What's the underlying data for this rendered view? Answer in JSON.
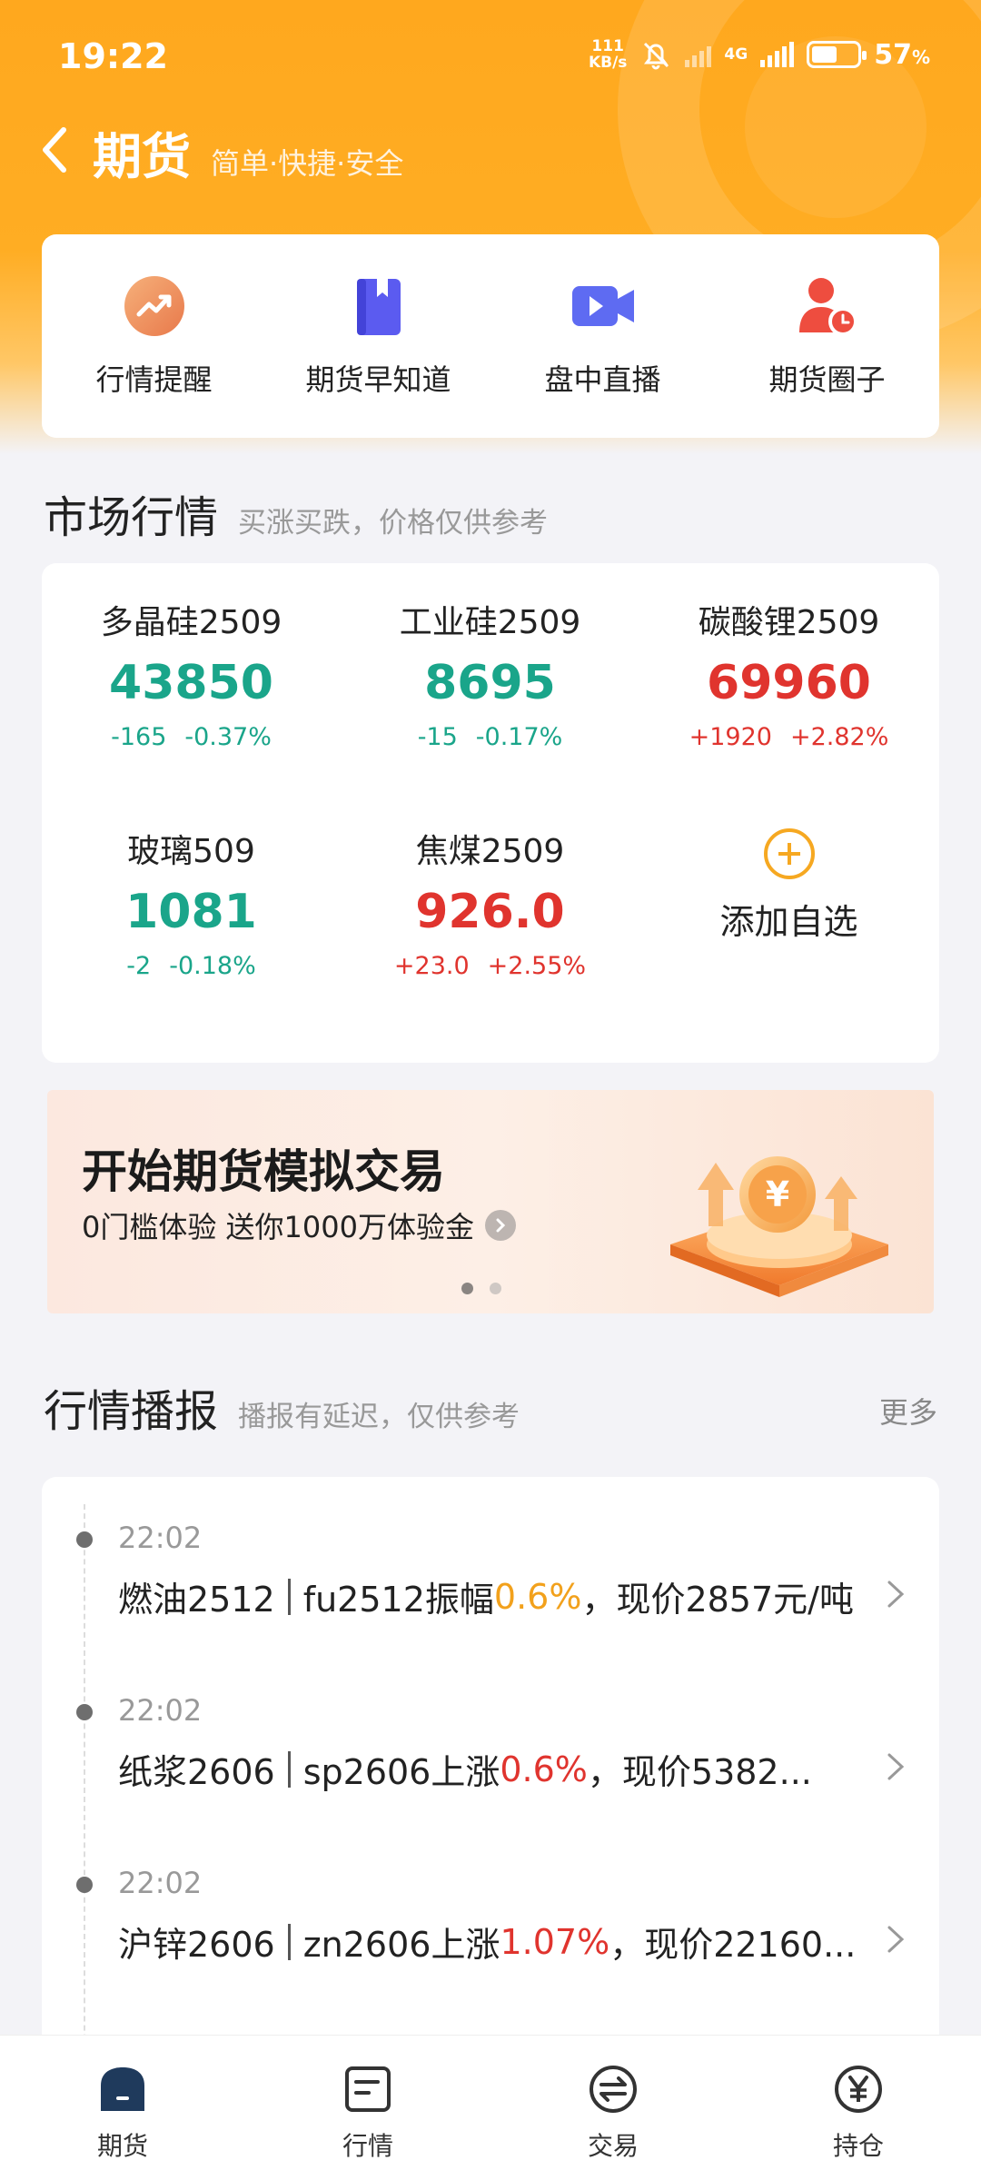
{
  "status_bar": {
    "time": "19:22",
    "speed_value": "111",
    "speed_unit": "KB/s",
    "network": "4G",
    "battery": "57",
    "battery_unit": "%"
  },
  "nav": {
    "title": "期货",
    "subtitle": "简单·快捷·安全"
  },
  "quick": [
    {
      "label": "行情提醒",
      "icon": "trend-alert-icon"
    },
    {
      "label": "期货早知道",
      "icon": "book-icon"
    },
    {
      "label": "盘中直播",
      "icon": "video-camera-icon"
    },
    {
      "label": "期货圈子",
      "icon": "user-clock-icon"
    }
  ],
  "market": {
    "title": "市场行情",
    "subtitle": "买涨买跌，价格仅供参考",
    "items": [
      {
        "name": "多晶硅2509",
        "price": "43850",
        "change": "-165",
        "pct": "-0.37%",
        "trend": "down"
      },
      {
        "name": "工业硅2509",
        "price": "8695",
        "change": "-15",
        "pct": "-0.17%",
        "trend": "down"
      },
      {
        "name": "碳酸锂2509",
        "price": "69960",
        "change": "+1920",
        "pct": "+2.82%",
        "trend": "up"
      },
      {
        "name": "玻璃509",
        "price": "1081",
        "change": "-2",
        "pct": "-0.18%",
        "trend": "down"
      },
      {
        "name": "焦煤2509",
        "price": "926.0",
        "change": "+23.0",
        "pct": "+2.55%",
        "trend": "up"
      }
    ],
    "add_label": "添加自选"
  },
  "banner": {
    "title": "开始期货模拟交易",
    "subtitle": "0门槛体验 送你1000万体验金"
  },
  "news": {
    "title": "行情播报",
    "subtitle": "播报有延迟，仅供参考",
    "more": "更多",
    "items": [
      {
        "time": "22:02",
        "name": "燃油2512",
        "pre": "fu2512振幅",
        "pct": "0.6%",
        "post": "，现价2857元/吨",
        "color": "orange"
      },
      {
        "time": "22:02",
        "name": "纸浆2606",
        "pre": "sp2606上涨",
        "pct": "0.6%",
        "post": "，现价5382...",
        "color": "red"
      },
      {
        "time": "22:02",
        "name": "沪锌2606",
        "pre": "zn2606上涨",
        "pct": "1.07%",
        "post": "，现价22160...",
        "color": "red"
      }
    ]
  },
  "tabs": [
    {
      "label": "期货",
      "icon": "home-icon"
    },
    {
      "label": "行情",
      "icon": "quote-icon"
    },
    {
      "label": "交易",
      "icon": "exchange-icon"
    },
    {
      "label": "持仓",
      "icon": "yen-icon"
    }
  ],
  "colors": {
    "brand": "#FFA81E",
    "up": "#E0342E",
    "down": "#1AA58A",
    "amplitude": "#F2A11C"
  }
}
